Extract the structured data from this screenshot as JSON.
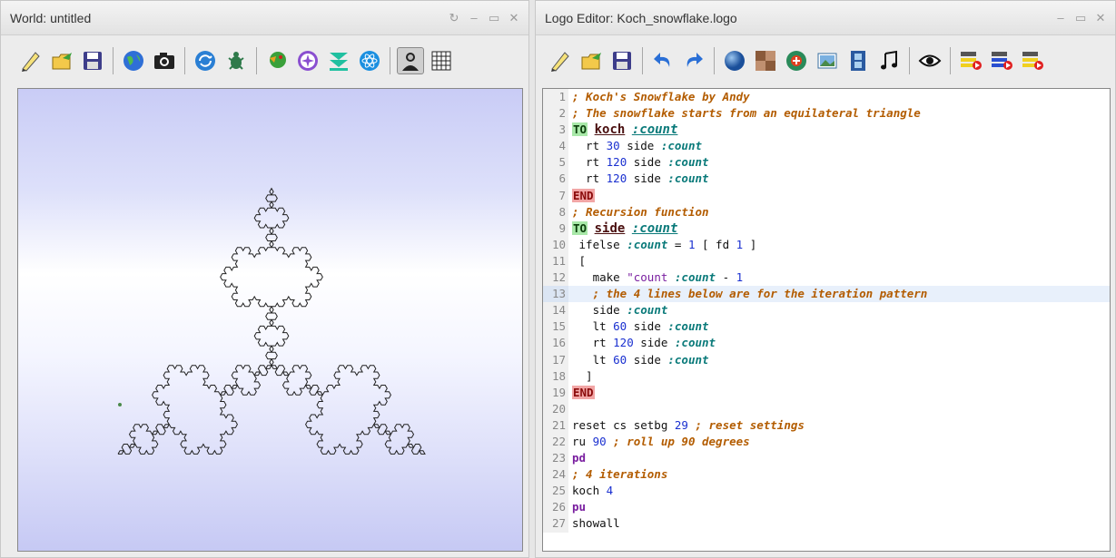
{
  "world": {
    "title": "World: untitled",
    "toolbar_icons": [
      "new-icon",
      "open-icon",
      "save-icon",
      "globe-icon",
      "camera-icon",
      "refresh-icon",
      "turtle-icon",
      "parrot-icon",
      "compass-icon",
      "download-icon",
      "atom-icon",
      "avatar-icon",
      "grid-icon"
    ]
  },
  "editor": {
    "title": "Logo Editor: Koch_snowflake.logo",
    "toolbar_icons": [
      "new-icon",
      "open-icon",
      "save-icon",
      "undo-icon",
      "redo-icon",
      "sphere-icon",
      "texture-icon",
      "add-object-icon",
      "image-icon",
      "film-icon",
      "music-icon",
      "eye-icon",
      "run-icon",
      "run-all-icon",
      "run-selection-icon"
    ],
    "highlighted_line": 13,
    "lines": [
      {
        "n": "1",
        "tokens": [
          {
            "t": "; Koch's Snowflake by Andy",
            "c": "cmt"
          }
        ]
      },
      {
        "n": "2",
        "tokens": [
          {
            "t": "; The snowflake starts from an equilateral triangle",
            "c": "cmt"
          }
        ]
      },
      {
        "n": "3",
        "tokens": [
          {
            "t": "TO",
            "c": "to"
          },
          {
            "t": " ",
            "c": "plain"
          },
          {
            "t": "koch",
            "c": "fname"
          },
          {
            "t": " ",
            "c": "plain"
          },
          {
            "t": ":count",
            "c": "uparam"
          }
        ]
      },
      {
        "n": "4",
        "tokens": [
          {
            "t": "  rt ",
            "c": "plain"
          },
          {
            "t": "30",
            "c": "num"
          },
          {
            "t": " side ",
            "c": "plain"
          },
          {
            "t": ":count",
            "c": "param"
          }
        ]
      },
      {
        "n": "5",
        "tokens": [
          {
            "t": "  rt ",
            "c": "plain"
          },
          {
            "t": "120",
            "c": "num"
          },
          {
            "t": " side ",
            "c": "plain"
          },
          {
            "t": ":count",
            "c": "param"
          }
        ]
      },
      {
        "n": "6",
        "tokens": [
          {
            "t": "  rt ",
            "c": "plain"
          },
          {
            "t": "120",
            "c": "num"
          },
          {
            "t": " side ",
            "c": "plain"
          },
          {
            "t": ":count",
            "c": "param"
          }
        ]
      },
      {
        "n": "7",
        "tokens": [
          {
            "t": "END",
            "c": "end"
          }
        ]
      },
      {
        "n": "8",
        "tokens": [
          {
            "t": "; Recursion function",
            "c": "cmt"
          }
        ]
      },
      {
        "n": "9",
        "tokens": [
          {
            "t": "TO",
            "c": "to"
          },
          {
            "t": " ",
            "c": "plain"
          },
          {
            "t": "side",
            "c": "fname"
          },
          {
            "t": " ",
            "c": "plain"
          },
          {
            "t": ":count",
            "c": "uparam"
          }
        ]
      },
      {
        "n": "10",
        "tokens": [
          {
            "t": " ifelse ",
            "c": "plain"
          },
          {
            "t": ":count",
            "c": "param"
          },
          {
            "t": " = ",
            "c": "plain"
          },
          {
            "t": "1",
            "c": "num"
          },
          {
            "t": " [ fd ",
            "c": "plain"
          },
          {
            "t": "1",
            "c": "num"
          },
          {
            "t": " ]",
            "c": "plain"
          }
        ]
      },
      {
        "n": "11",
        "tokens": [
          {
            "t": " [",
            "c": "plain"
          }
        ]
      },
      {
        "n": "12",
        "tokens": [
          {
            "t": "   make ",
            "c": "plain"
          },
          {
            "t": "\"count",
            "c": "str"
          },
          {
            "t": " ",
            "c": "plain"
          },
          {
            "t": ":count",
            "c": "param"
          },
          {
            "t": " - ",
            "c": "plain"
          },
          {
            "t": "1",
            "c": "num"
          }
        ]
      },
      {
        "n": "13",
        "tokens": [
          {
            "t": "   ; the 4 lines below are for the iteration pattern",
            "c": "cmt"
          }
        ]
      },
      {
        "n": "14",
        "tokens": [
          {
            "t": "   side ",
            "c": "plain"
          },
          {
            "t": ":count",
            "c": "param"
          }
        ]
      },
      {
        "n": "15",
        "tokens": [
          {
            "t": "   lt ",
            "c": "plain"
          },
          {
            "t": "60",
            "c": "num"
          },
          {
            "t": " side ",
            "c": "plain"
          },
          {
            "t": ":count",
            "c": "param"
          }
        ]
      },
      {
        "n": "16",
        "tokens": [
          {
            "t": "   rt ",
            "c": "plain"
          },
          {
            "t": "120",
            "c": "num"
          },
          {
            "t": " side ",
            "c": "plain"
          },
          {
            "t": ":count",
            "c": "param"
          }
        ]
      },
      {
        "n": "17",
        "tokens": [
          {
            "t": "   lt ",
            "c": "plain"
          },
          {
            "t": "60",
            "c": "num"
          },
          {
            "t": " side ",
            "c": "plain"
          },
          {
            "t": ":count",
            "c": "param"
          }
        ]
      },
      {
        "n": "18",
        "tokens": [
          {
            "t": "  ]",
            "c": "plain"
          }
        ]
      },
      {
        "n": "19",
        "tokens": [
          {
            "t": "END",
            "c": "end"
          }
        ]
      },
      {
        "n": "20",
        "tokens": []
      },
      {
        "n": "21",
        "tokens": [
          {
            "t": "reset cs setbg ",
            "c": "plain"
          },
          {
            "t": "29",
            "c": "num"
          },
          {
            "t": " ",
            "c": "plain"
          },
          {
            "t": "; reset settings",
            "c": "cmt"
          }
        ]
      },
      {
        "n": "22",
        "tokens": [
          {
            "t": "ru ",
            "c": "plain"
          },
          {
            "t": "90",
            "c": "num"
          },
          {
            "t": " ",
            "c": "plain"
          },
          {
            "t": "; roll up 90 degrees",
            "c": "cmt"
          }
        ]
      },
      {
        "n": "23",
        "tokens": [
          {
            "t": "pd",
            "c": "kw"
          }
        ]
      },
      {
        "n": "24",
        "tokens": [
          {
            "t": "; 4 iterations",
            "c": "cmt"
          }
        ]
      },
      {
        "n": "25",
        "tokens": [
          {
            "t": "koch ",
            "c": "plain"
          },
          {
            "t": "4",
            "c": "num"
          }
        ]
      },
      {
        "n": "26",
        "tokens": [
          {
            "t": "pu",
            "c": "kw"
          }
        ]
      },
      {
        "n": "27",
        "tokens": [
          {
            "t": "showall",
            "c": "plain"
          }
        ]
      }
    ]
  },
  "snowflake": {
    "iterations": 4,
    "stroke_color": "#222222"
  }
}
